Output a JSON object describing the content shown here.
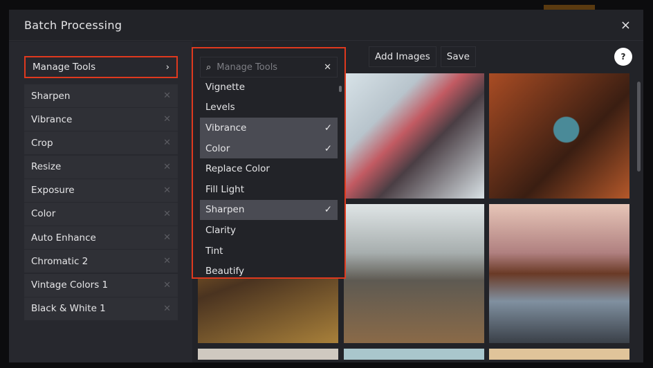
{
  "modal": {
    "title": "Batch Processing",
    "close_icon": "×"
  },
  "sidebar": {
    "manage_tools_label": "Manage Tools",
    "chevron": "›",
    "tools": [
      "Sharpen",
      "Vibrance",
      "Crop",
      "Resize",
      "Exposure",
      "Color",
      "Auto Enhance",
      "Chromatic 2",
      "Vintage Colors 1",
      "Black & White 1"
    ]
  },
  "toolbar": {
    "add_images": "Add Images",
    "save": "Save",
    "help": "?"
  },
  "dropdown": {
    "placeholder": "Manage Tools",
    "items": [
      {
        "label": "Vignette",
        "selected": false
      },
      {
        "label": "Levels",
        "selected": false
      },
      {
        "label": "Vibrance",
        "selected": true
      },
      {
        "label": "Color",
        "selected": true
      },
      {
        "label": "Replace Color",
        "selected": false
      },
      {
        "label": "Fill Light",
        "selected": false
      },
      {
        "label": "Sharpen",
        "selected": true
      },
      {
        "label": "Clarity",
        "selected": false
      },
      {
        "label": "Tint",
        "selected": false
      },
      {
        "label": "Beautify",
        "selected": false
      }
    ]
  },
  "accent": "#e0391e"
}
